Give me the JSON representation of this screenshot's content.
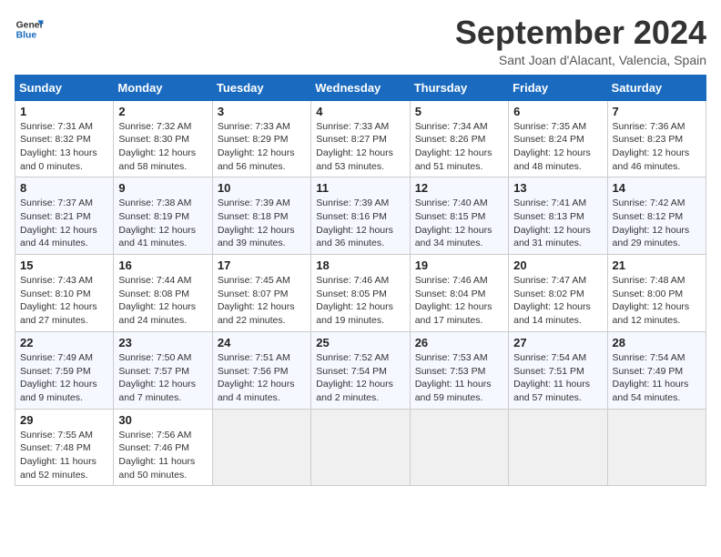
{
  "logo": {
    "line1": "General",
    "line2": "Blue"
  },
  "header": {
    "title": "September 2024",
    "subtitle": "Sant Joan d'Alacant, Valencia, Spain"
  },
  "weekdays": [
    "Sunday",
    "Monday",
    "Tuesday",
    "Wednesday",
    "Thursday",
    "Friday",
    "Saturday"
  ],
  "weeks": [
    [
      {
        "day": "1",
        "info": "Sunrise: 7:31 AM\nSunset: 8:32 PM\nDaylight: 13 hours\nand 0 minutes."
      },
      {
        "day": "2",
        "info": "Sunrise: 7:32 AM\nSunset: 8:30 PM\nDaylight: 12 hours\nand 58 minutes."
      },
      {
        "day": "3",
        "info": "Sunrise: 7:33 AM\nSunset: 8:29 PM\nDaylight: 12 hours\nand 56 minutes."
      },
      {
        "day": "4",
        "info": "Sunrise: 7:33 AM\nSunset: 8:27 PM\nDaylight: 12 hours\nand 53 minutes."
      },
      {
        "day": "5",
        "info": "Sunrise: 7:34 AM\nSunset: 8:26 PM\nDaylight: 12 hours\nand 51 minutes."
      },
      {
        "day": "6",
        "info": "Sunrise: 7:35 AM\nSunset: 8:24 PM\nDaylight: 12 hours\nand 48 minutes."
      },
      {
        "day": "7",
        "info": "Sunrise: 7:36 AM\nSunset: 8:23 PM\nDaylight: 12 hours\nand 46 minutes."
      }
    ],
    [
      {
        "day": "8",
        "info": "Sunrise: 7:37 AM\nSunset: 8:21 PM\nDaylight: 12 hours\nand 44 minutes."
      },
      {
        "day": "9",
        "info": "Sunrise: 7:38 AM\nSunset: 8:19 PM\nDaylight: 12 hours\nand 41 minutes."
      },
      {
        "day": "10",
        "info": "Sunrise: 7:39 AM\nSunset: 8:18 PM\nDaylight: 12 hours\nand 39 minutes."
      },
      {
        "day": "11",
        "info": "Sunrise: 7:39 AM\nSunset: 8:16 PM\nDaylight: 12 hours\nand 36 minutes."
      },
      {
        "day": "12",
        "info": "Sunrise: 7:40 AM\nSunset: 8:15 PM\nDaylight: 12 hours\nand 34 minutes."
      },
      {
        "day": "13",
        "info": "Sunrise: 7:41 AM\nSunset: 8:13 PM\nDaylight: 12 hours\nand 31 minutes."
      },
      {
        "day": "14",
        "info": "Sunrise: 7:42 AM\nSunset: 8:12 PM\nDaylight: 12 hours\nand 29 minutes."
      }
    ],
    [
      {
        "day": "15",
        "info": "Sunrise: 7:43 AM\nSunset: 8:10 PM\nDaylight: 12 hours\nand 27 minutes."
      },
      {
        "day": "16",
        "info": "Sunrise: 7:44 AM\nSunset: 8:08 PM\nDaylight: 12 hours\nand 24 minutes."
      },
      {
        "day": "17",
        "info": "Sunrise: 7:45 AM\nSunset: 8:07 PM\nDaylight: 12 hours\nand 22 minutes."
      },
      {
        "day": "18",
        "info": "Sunrise: 7:46 AM\nSunset: 8:05 PM\nDaylight: 12 hours\nand 19 minutes."
      },
      {
        "day": "19",
        "info": "Sunrise: 7:46 AM\nSunset: 8:04 PM\nDaylight: 12 hours\nand 17 minutes."
      },
      {
        "day": "20",
        "info": "Sunrise: 7:47 AM\nSunset: 8:02 PM\nDaylight: 12 hours\nand 14 minutes."
      },
      {
        "day": "21",
        "info": "Sunrise: 7:48 AM\nSunset: 8:00 PM\nDaylight: 12 hours\nand 12 minutes."
      }
    ],
    [
      {
        "day": "22",
        "info": "Sunrise: 7:49 AM\nSunset: 7:59 PM\nDaylight: 12 hours\nand 9 minutes."
      },
      {
        "day": "23",
        "info": "Sunrise: 7:50 AM\nSunset: 7:57 PM\nDaylight: 12 hours\nand 7 minutes."
      },
      {
        "day": "24",
        "info": "Sunrise: 7:51 AM\nSunset: 7:56 PM\nDaylight: 12 hours\nand 4 minutes."
      },
      {
        "day": "25",
        "info": "Sunrise: 7:52 AM\nSunset: 7:54 PM\nDaylight: 12 hours\nand 2 minutes."
      },
      {
        "day": "26",
        "info": "Sunrise: 7:53 AM\nSunset: 7:53 PM\nDaylight: 11 hours\nand 59 minutes."
      },
      {
        "day": "27",
        "info": "Sunrise: 7:54 AM\nSunset: 7:51 PM\nDaylight: 11 hours\nand 57 minutes."
      },
      {
        "day": "28",
        "info": "Sunrise: 7:54 AM\nSunset: 7:49 PM\nDaylight: 11 hours\nand 54 minutes."
      }
    ],
    [
      {
        "day": "29",
        "info": "Sunrise: 7:55 AM\nSunset: 7:48 PM\nDaylight: 11 hours\nand 52 minutes."
      },
      {
        "day": "30",
        "info": "Sunrise: 7:56 AM\nSunset: 7:46 PM\nDaylight: 11 hours\nand 50 minutes."
      },
      {
        "day": "",
        "info": ""
      },
      {
        "day": "",
        "info": ""
      },
      {
        "day": "",
        "info": ""
      },
      {
        "day": "",
        "info": ""
      },
      {
        "day": "",
        "info": ""
      }
    ]
  ]
}
